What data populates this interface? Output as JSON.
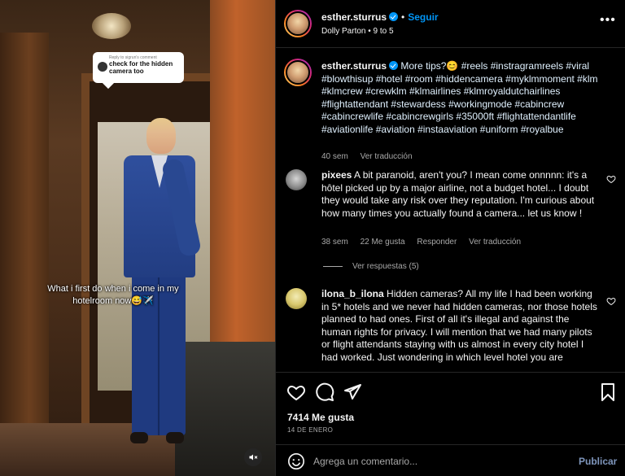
{
  "video": {
    "reply_small": "Reply to sigrun's comment",
    "reply_text": "check for the hidden camera too",
    "caption": "What i first do when i come in my hotelroom now😅✈️",
    "mute_icon": "speaker-muted-icon"
  },
  "header": {
    "username": "esther.sturrus",
    "follow_label": "Seguir",
    "separator": "•",
    "music": "Dolly Parton • 9 to 5",
    "more_label": "•••"
  },
  "caption": {
    "username": "esther.sturrus",
    "text": "More tips?😊 #reels #instragramreels #viral #blowthisup #hotel #room #hiddencamera #myklmmoment #klm #klmcrew #crewklm #klmairlines #klmroyaldutchairlines #flightattendant #stewardess #workingmode #cabincrew #cabincrewlife #cabincrewgirls #35000ft #flightattendantlife #aviationlife #aviation #instaaviation #uniform #royalbue",
    "time": "40 sem",
    "translate": "Ver traducción"
  },
  "comments": [
    {
      "username": "pixees",
      "text": "A bit paranoid, aren't you? I mean come onnnnn: it's a hôtel picked up by a major airline, not a budget hotel... I doubt they would take any risk over they reputation. I'm curious about how many times you actually found a camera... let us know !",
      "time": "38 sem",
      "likes": "22 Me gusta",
      "reply": "Responder",
      "translate": "Ver traducción",
      "view_replies": "Ver respuestas (5)"
    },
    {
      "username": "ilona_b_ilona",
      "text": "Hidden cameras? All my life I had been working in 5* hotels and we never had hidden cameras, nor those hotels planned to had ones. First of all it's illegal and against the human rights for privacy. I will mention that we had many pilots or flight attendants staying with us almost in every city hotel I had worked. Just wondering in which level hotel you are"
    }
  ],
  "actions": {
    "likes": "7414 Me gusta",
    "date": "14 DE ENERO"
  },
  "add_comment": {
    "placeholder": "Agrega un comentario...",
    "publish_label": "Publicar"
  },
  "colors": {
    "accent": "#0095f6",
    "muted": "#a8a8a8",
    "background": "#000000",
    "divider": "#262626"
  }
}
